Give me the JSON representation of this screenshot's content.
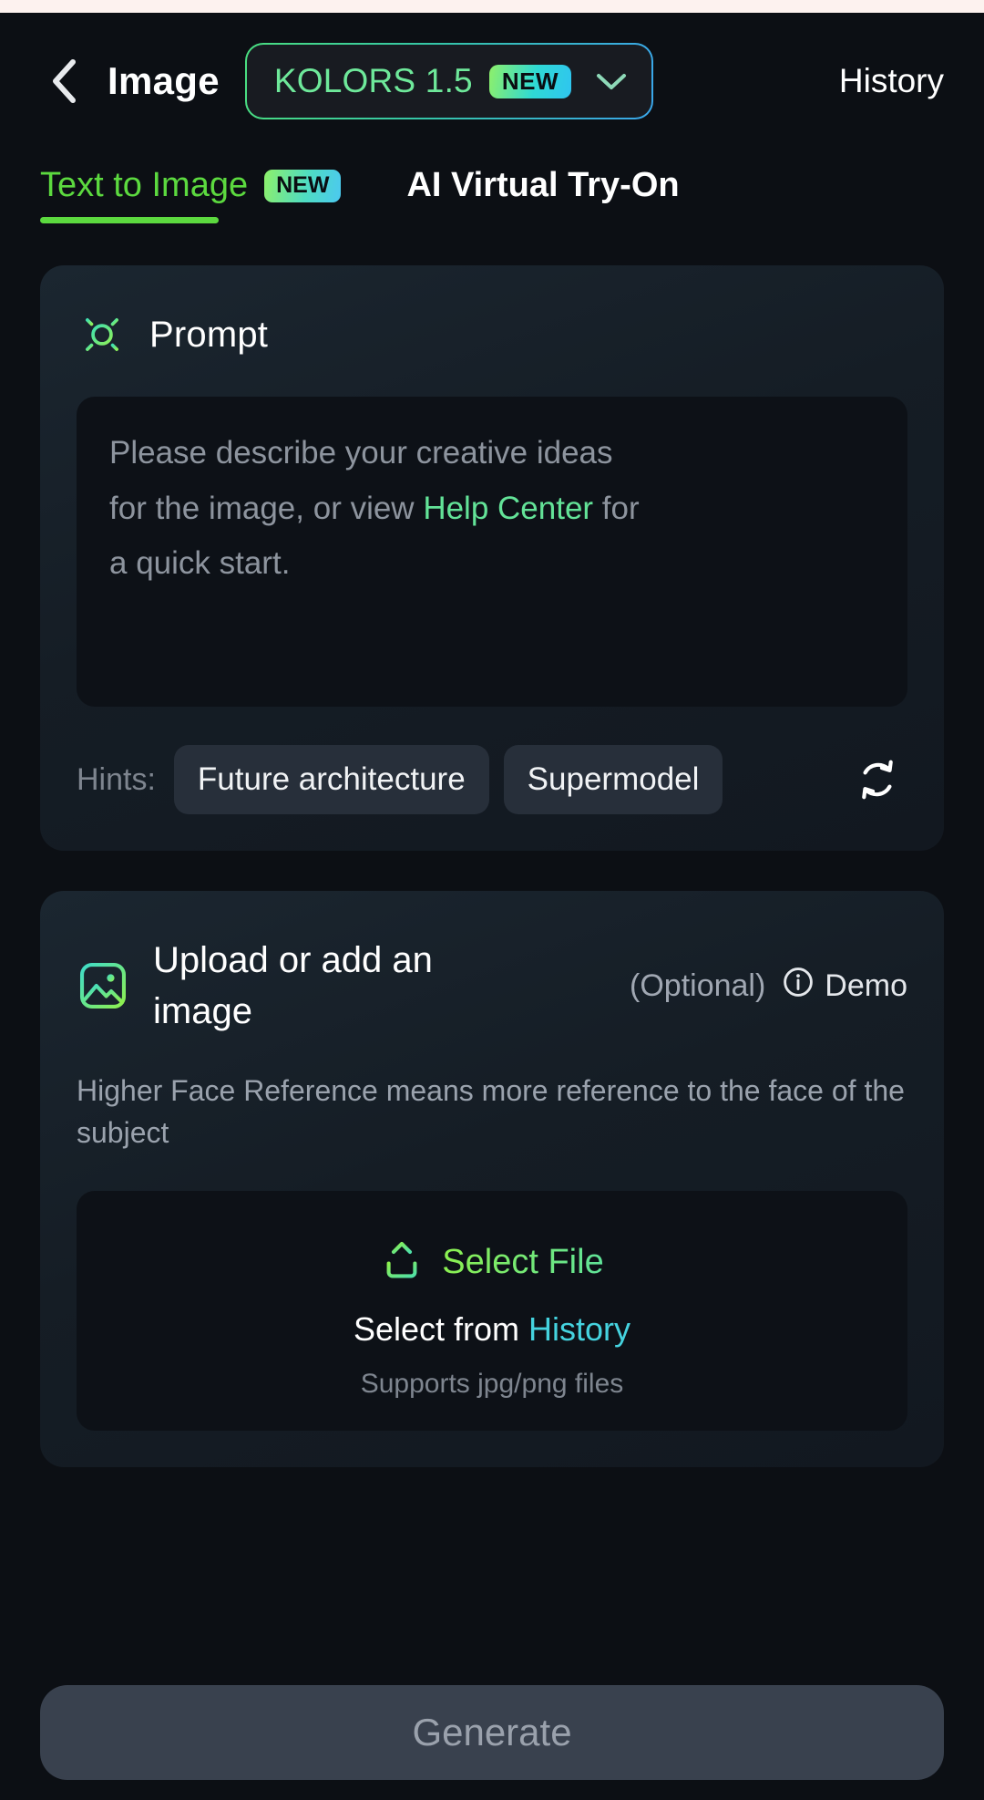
{
  "header": {
    "back_icon": "chevron-left-icon",
    "title": "Image",
    "model": {
      "name": "KOLORS 1.5",
      "badge": "NEW",
      "chevron_icon": "chevron-down-icon"
    },
    "history_label": "History"
  },
  "tabs": [
    {
      "label": "Text to Image",
      "badge": "NEW",
      "active": true
    },
    {
      "label": "AI Virtual Try-On",
      "badge": "",
      "active": false
    }
  ],
  "prompt_card": {
    "icon": "sun-brightness-icon",
    "title": "Prompt",
    "placeholder_part1": "Please describe your creative ideas for the image, or view ",
    "placeholder_link": "Help Center",
    "placeholder_part2": " for a quick start.",
    "hints_label": "Hints:",
    "hints": [
      "Future architecture",
      "Supermodel"
    ],
    "refresh_icon": "refresh-sync-icon"
  },
  "upload_card": {
    "icon": "image-picture-icon",
    "title": "Upload or add an image",
    "optional_label": "(Optional)",
    "demo_icon": "info-circle-icon",
    "demo_label": "Demo",
    "description": "Higher Face Reference means more reference to the face of the subject",
    "dropzone": {
      "upload_icon": "upload-arrow-icon",
      "select_file_label": "Select File",
      "select_from_label": "Select from",
      "history_link": "History",
      "supports_label": "Supports jpg/png files"
    }
  },
  "footer": {
    "generate_label": "Generate"
  },
  "colors": {
    "page_bg": "#0c0f14",
    "card_bg": "#18212b",
    "input_bg": "#0d1117",
    "accent_green": "#5cd93f",
    "accent_mint": "#63e398",
    "accent_cyan": "#45d3df",
    "chip_bg": "#272f3a",
    "generate_bg": "#39414e",
    "status_strip": "#fdf2ef"
  }
}
